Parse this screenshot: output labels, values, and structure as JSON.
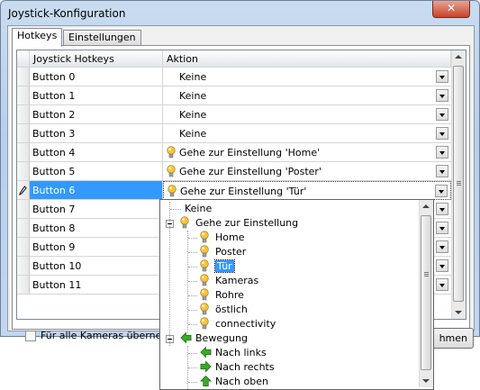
{
  "window": {
    "title": "Joystick-Konfiguration",
    "close_glyph": "✕"
  },
  "tabs": [
    {
      "label": "Hotkeys",
      "active": true
    },
    {
      "label": "Einstellungen",
      "active": false
    }
  ],
  "grid": {
    "columns": [
      "Joystick Hotkeys",
      "Aktion"
    ],
    "rows": [
      {
        "button": "Button 0",
        "action": "Keine",
        "icon": null
      },
      {
        "button": "Button 1",
        "action": "Keine",
        "icon": null
      },
      {
        "button": "Button 2",
        "action": "Keine",
        "icon": null
      },
      {
        "button": "Button 3",
        "action": "Keine",
        "icon": null
      },
      {
        "button": "Button 4",
        "action": "Gehe zur Einstellung 'Home'",
        "icon": "lightbulb-icon"
      },
      {
        "button": "Button 5",
        "action": "Gehe zur Einstellung 'Poster'",
        "icon": "lightbulb-icon"
      },
      {
        "button": "Button 6",
        "action": "Gehe zur Einstellung 'Tür'",
        "icon": "lightbulb-icon",
        "selected": true,
        "row_icon": "pencil-icon"
      },
      {
        "button": "Button 7",
        "action": "",
        "icon": null
      },
      {
        "button": "Button 8",
        "action": "",
        "icon": null
      },
      {
        "button": "Button 9",
        "action": "",
        "icon": null
      },
      {
        "button": "Button 10",
        "action": "",
        "icon": null
      },
      {
        "button": "Button 11",
        "action": "",
        "icon": null
      }
    ]
  },
  "apply_all": {
    "label": "Für alle Kameras übernehmen",
    "checked": false
  },
  "ok_button": {
    "label": "hmen"
  },
  "dropdown_tree": {
    "items": [
      {
        "label": "Keine",
        "level": 1,
        "icon": null
      },
      {
        "label": "Gehe zur Einstellung",
        "level": 0,
        "icon": "lightbulb-icon",
        "expanded": true
      },
      {
        "label": "Home",
        "level": 1,
        "icon": "lightbulb-icon"
      },
      {
        "label": "Poster",
        "level": 1,
        "icon": "lightbulb-icon"
      },
      {
        "label": "Tür",
        "level": 1,
        "icon": "lightbulb-icon",
        "selected": true
      },
      {
        "label": "Kameras",
        "level": 1,
        "icon": "lightbulb-icon"
      },
      {
        "label": "Rohre",
        "level": 1,
        "icon": "lightbulb-icon"
      },
      {
        "label": "östlich",
        "level": 1,
        "icon": "lightbulb-icon"
      },
      {
        "label": "connectivity",
        "level": 1,
        "icon": "lightbulb-icon"
      },
      {
        "label": "Bewegung",
        "level": 0,
        "icon": "arrow-left-icon",
        "expanded": true
      },
      {
        "label": "Nach links",
        "level": 1,
        "icon": "arrow-left-icon"
      },
      {
        "label": "Nach rechts",
        "level": 1,
        "icon": "arrow-right-icon"
      },
      {
        "label": "Nach oben",
        "level": 1,
        "icon": "arrow-up-icon"
      }
    ]
  },
  "colors": {
    "selection": "#3399ff",
    "bulb": "#f5c542",
    "arrow_green": "#3aa829"
  }
}
